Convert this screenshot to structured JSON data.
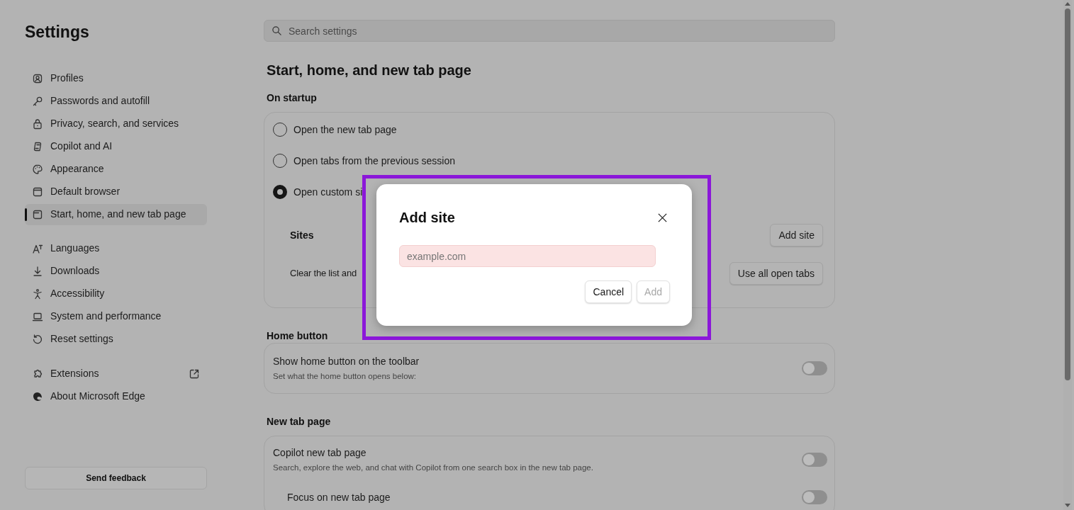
{
  "sidebar": {
    "title": "Settings",
    "sections": [
      {
        "items": [
          {
            "label": "Profiles",
            "selected": false,
            "external": false
          },
          {
            "label": "Passwords and autofill",
            "selected": false,
            "external": false
          },
          {
            "label": "Privacy, search, and services",
            "selected": false,
            "external": false
          },
          {
            "label": "Copilot and AI",
            "selected": false,
            "external": false
          },
          {
            "label": "Appearance",
            "selected": false,
            "external": false
          },
          {
            "label": "Default browser",
            "selected": false,
            "external": false
          },
          {
            "label": "Start, home, and new tab page",
            "selected": true,
            "external": false
          }
        ]
      },
      {
        "items": [
          {
            "label": "Languages",
            "selected": false,
            "external": false
          },
          {
            "label": "Downloads",
            "selected": false,
            "external": false
          },
          {
            "label": "Accessibility",
            "selected": false,
            "external": false
          },
          {
            "label": "System and performance",
            "selected": false,
            "external": false
          },
          {
            "label": "Reset settings",
            "selected": false,
            "external": false
          }
        ]
      },
      {
        "items": [
          {
            "label": "Extensions",
            "selected": false,
            "external": true
          },
          {
            "label": "About Microsoft Edge",
            "selected": false,
            "external": false
          }
        ]
      }
    ],
    "feedback_button": "Send feedback"
  },
  "search": {
    "placeholder": "Search settings"
  },
  "page_title": "Start, home, and new tab page",
  "startup": {
    "heading": "On startup",
    "options": [
      {
        "label": "Open the new tab page",
        "selected": false
      },
      {
        "label": "Open tabs from the previous session",
        "selected": false
      },
      {
        "label": "Open custom si",
        "selected": true
      }
    ],
    "rows": [
      {
        "kind": "heading",
        "label": "Sites",
        "button": "Add site"
      },
      {
        "kind": "text",
        "label": "Clear the list and",
        "button": "Use all open tabs"
      }
    ]
  },
  "home_button": {
    "heading": "Home button",
    "toggles": [
      {
        "title": "Show home button on the toolbar",
        "description": "Set what the home button opens below:",
        "on": false
      }
    ]
  },
  "new_tab_page": {
    "heading": "New tab page",
    "toggles": [
      {
        "title": "Copilot new tab page",
        "description": "Search, explore the web, and chat with Copilot from one search box in the new tab page.",
        "on": false,
        "children": [
          {
            "title": "Focus on new tab page",
            "on": false
          }
        ]
      }
    ]
  },
  "dialog": {
    "title": "Add site",
    "placeholder": "example.com",
    "invalid": true,
    "buttons": [
      {
        "label": "Cancel",
        "disabled": false
      },
      {
        "label": "Add",
        "disabled": true
      }
    ]
  }
}
